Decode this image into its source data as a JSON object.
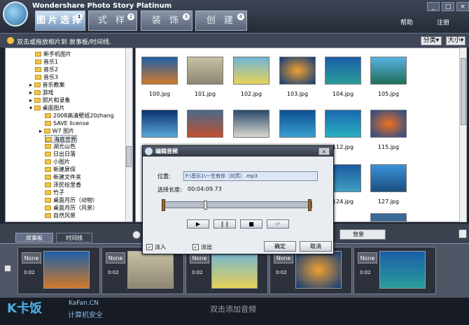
{
  "app": {
    "title": "Wondershare Photo Story Platinum",
    "help": "帮助",
    "register": "注册"
  },
  "tabs": [
    {
      "label": "图片选择"
    },
    {
      "label": "式 样"
    },
    {
      "label": "装 饰"
    },
    {
      "label": "创 建"
    }
  ],
  "hint": "双击或拖放相片到 故事板/时间线.",
  "sort_label": "分类▾",
  "size_label": "大小▾",
  "tree": [
    "新手机图片",
    "音乐1",
    "音乐2",
    "音乐3",
    "音乐教案",
    "游戏",
    "照片和录象",
    "桌面图片",
    "2008高清壁纸20zhang",
    "SAVE license",
    "W7 图片",
    "海底世界",
    "湖光山色",
    "日出日落",
    "小图片",
    "新建屏保",
    "新建文件夹",
    "泽民绘里香",
    "竹子",
    "桌面月历（动物）",
    "桌面月历（风景）",
    "自然风景"
  ],
  "thumbs": [
    "100.jpg",
    "101.jpg",
    "102.jpg",
    "103.jpg",
    "104.jpg",
    "105.jpg",
    "",
    "",
    "",
    "",
    "112.jpg",
    "115.jpg",
    "",
    "",
    "",
    "",
    "124.jpg",
    "127.jpg"
  ],
  "colors": {
    "accent": "#2b6fa8",
    "titlebar": "#2f3644",
    "dialog": "#e9ecf0"
  },
  "story_tabs": {
    "storyboard": "故事板",
    "timeline": "时间线"
  },
  "background_btn": "背景",
  "cards": [
    {
      "none": "None",
      "dur": "0:02"
    },
    {
      "none": "None",
      "dur": "0:02"
    },
    {
      "none": "None",
      "dur": "0:02"
    },
    {
      "none": "None",
      "dur": "0:02"
    },
    {
      "none": "None",
      "dur": "0:02"
    }
  ],
  "audio_hint": "双击添加音频",
  "dialog": {
    "title": "编辑音频",
    "pos_label": "位置:",
    "path": "F:\\音乐1\\一生有你（刘芳）.mp3",
    "len_label": "选择长度:",
    "len_value": "00:04:09.73",
    "fadein": "淡入",
    "fadeout": "淡出",
    "ok": "确定",
    "cancel": "取消"
  },
  "watermark": {
    "brand": "K卡饭",
    "site": "KaFan.CN",
    "sub": "计算机安全"
  }
}
